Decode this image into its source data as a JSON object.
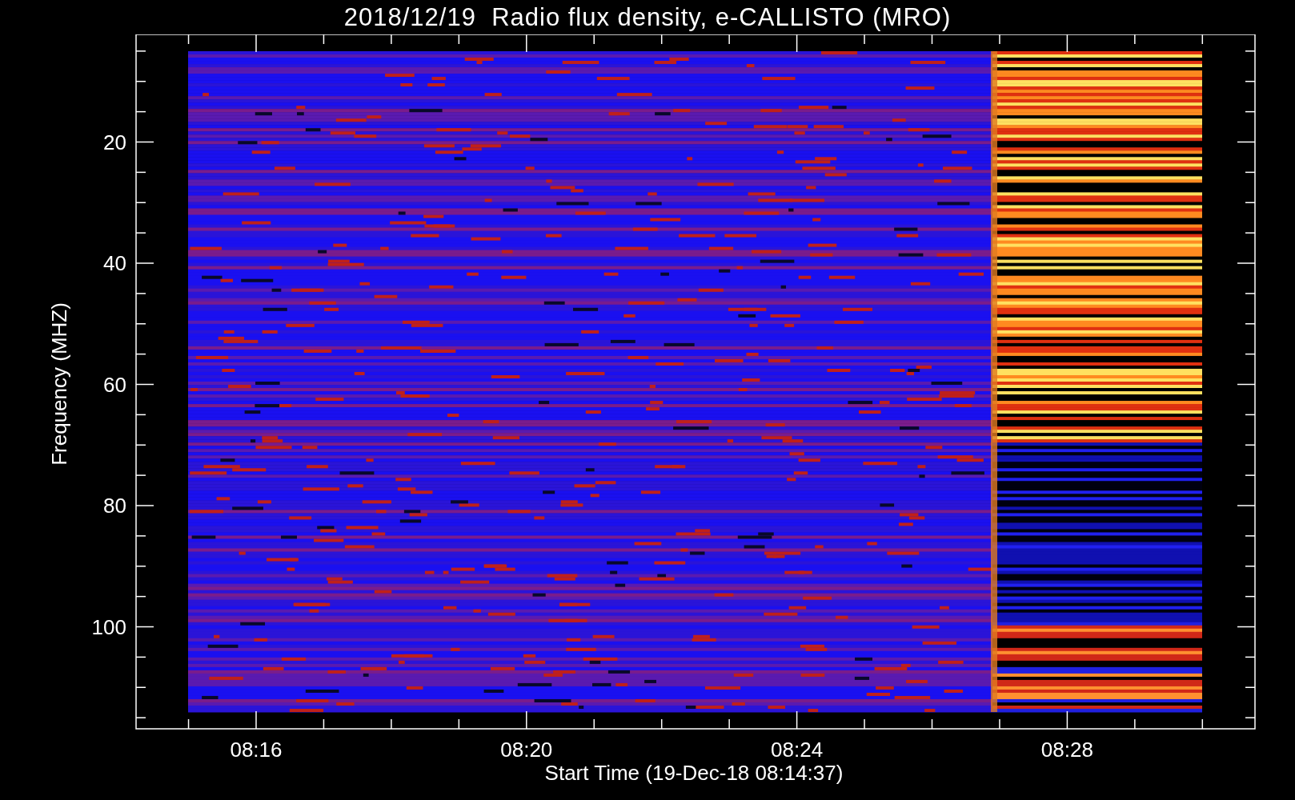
{
  "title": "2018/12/19  Radio flux density, e-CALLISTO (MRO)",
  "y_axis": {
    "label": "Frequency (MHZ)",
    "ticks": [
      "20",
      "40",
      "60",
      "80",
      "100"
    ]
  },
  "x_axis": {
    "label": "Start Time (19-Dec-18 08:14:37)",
    "ticks": [
      "08:16",
      "08:20",
      "08:24",
      "08:28"
    ]
  }
}
